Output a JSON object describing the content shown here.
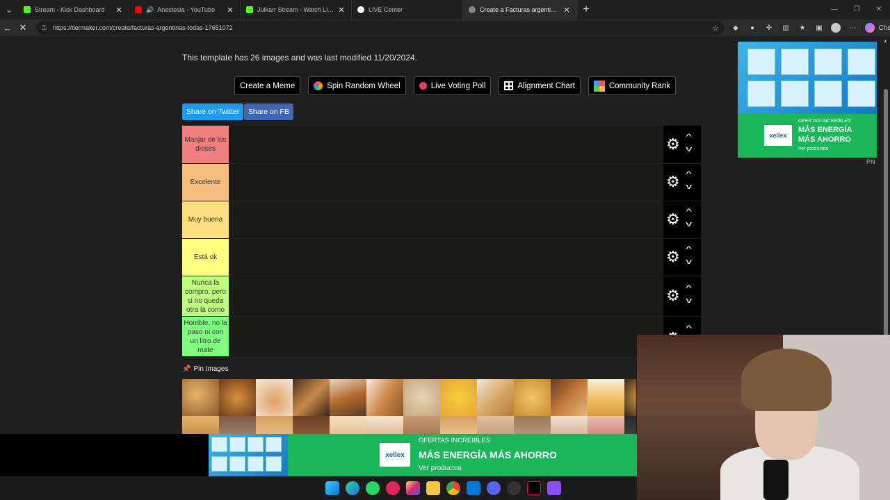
{
  "browser": {
    "tabs": [
      {
        "title": "Stream - Kick Dashboard",
        "color": "#53fc18"
      },
      {
        "title": "Anestesia - YouTube",
        "color": "#ff0000"
      },
      {
        "title": "Julkarr Stream - Watch Live on Kick",
        "color": "#53fc18"
      },
      {
        "title": "LIVE Center",
        "color": "#ffffff"
      },
      {
        "title": "Create a Facturas argentinas (TODAS) Tier List",
        "color": "#888888"
      }
    ],
    "url": "https://tiermaker.com/create/facturas-argentinas-todas-17651072",
    "chat_label": "Chat"
  },
  "page": {
    "info_text": "This template has 26 images and was last modified 11/20/2024.",
    "buttons": {
      "create_meme": "Create a Meme",
      "spin_wheel": "Spin Random Wheel",
      "voting_poll": "Live Voting Poll",
      "alignment_chart": "Alignment Chart",
      "community_rank": "Community Rank"
    },
    "share_twitter": "Share on Twitter",
    "share_fb": "Share on FB",
    "tiers": [
      {
        "label": "Manjar de los dioses",
        "color": "#f07f7f"
      },
      {
        "label": "Excelente",
        "color": "#f7bf7f"
      },
      {
        "label": "Muy buena",
        "color": "#fddf7f"
      },
      {
        "label": "Está ok",
        "color": "#fefe7f"
      },
      {
        "label": "Nunca la compro, pero si no queda otra la como",
        "color": "#bfff7f"
      },
      {
        "label": "Horrible, no la paso ni con un litro de mate",
        "color": "#7fff7f"
      }
    ],
    "pin_images_label": "Pin Images"
  },
  "ads": {
    "bottom": {
      "brand": "xellex",
      "line1": "OFERTAS INCREIBLES",
      "line2": "MÁS ENERGÍA MÁS AHORRO",
      "line3": "Ver productos"
    },
    "side": {
      "brand": "xellex",
      "line1": "OFERTAS INCREIBLES",
      "line2a": "MÁS ENERGÍA",
      "line2b": "MÁS AHORRO",
      "line3": "Ver productos",
      "corner": "PN"
    }
  }
}
